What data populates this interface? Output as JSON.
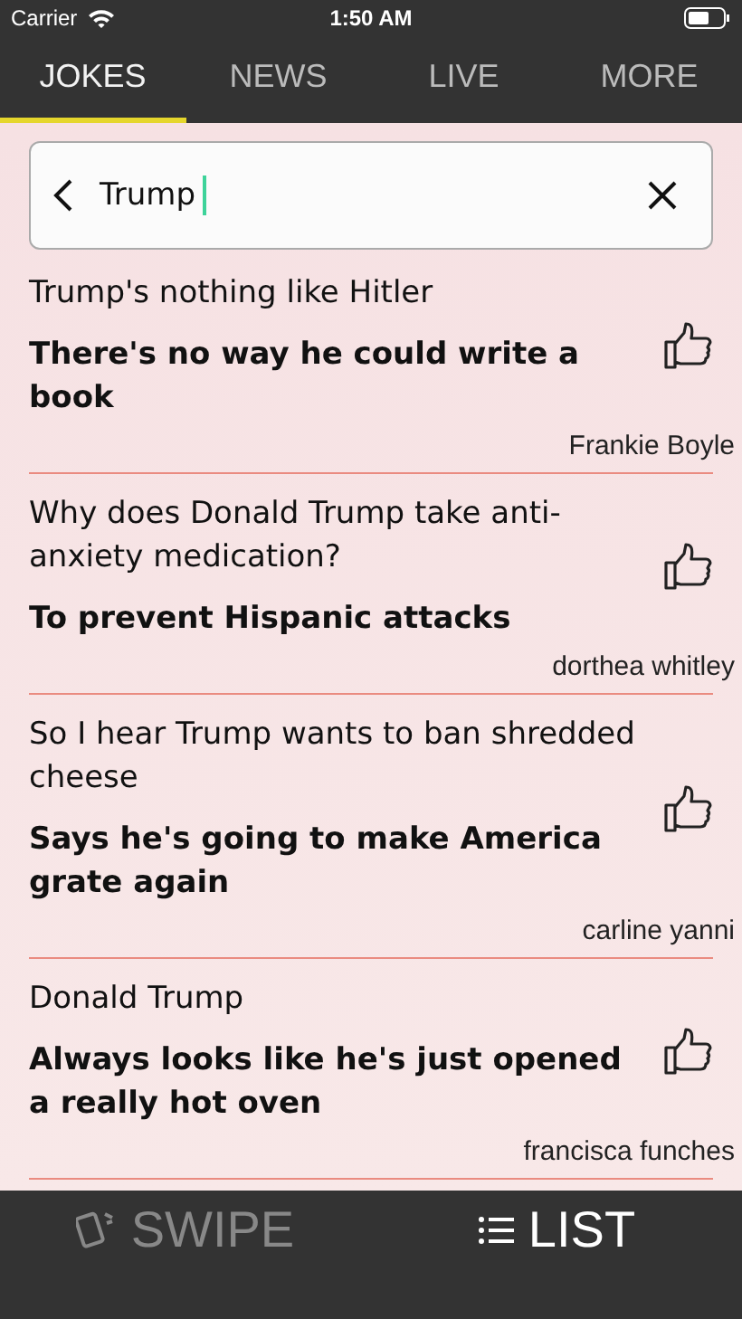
{
  "status_bar": {
    "carrier": "Carrier",
    "time": "1:50 AM"
  },
  "tabs": [
    {
      "label": "JOKES",
      "selected": true
    },
    {
      "label": "NEWS",
      "selected": false
    },
    {
      "label": "LIVE",
      "selected": false
    },
    {
      "label": "MORE",
      "selected": false
    }
  ],
  "search": {
    "value": "Trump"
  },
  "jokes": [
    {
      "setup": "Trump's nothing like Hitler",
      "punchline": "There's no way he could write a book",
      "author": "Frankie Boyle"
    },
    {
      "setup": "Why does Donald Trump take anti-anxiety medication?",
      "punchline": "To prevent Hispanic attacks",
      "author": "dorthea whitley"
    },
    {
      "setup": "So I hear Trump wants to ban shredded cheese",
      "punchline": "Says he's going to make America grate again",
      "author": "carline yanni"
    },
    {
      "setup": "Donald Trump",
      "punchline": "Always looks like he's just opened a really hot oven",
      "author": "francisca funches"
    }
  ],
  "bottom_tabs": [
    {
      "label": "SWIPE",
      "kind": "swipe",
      "selected": false
    },
    {
      "label": "LIST",
      "kind": "list",
      "selected": true
    }
  ]
}
